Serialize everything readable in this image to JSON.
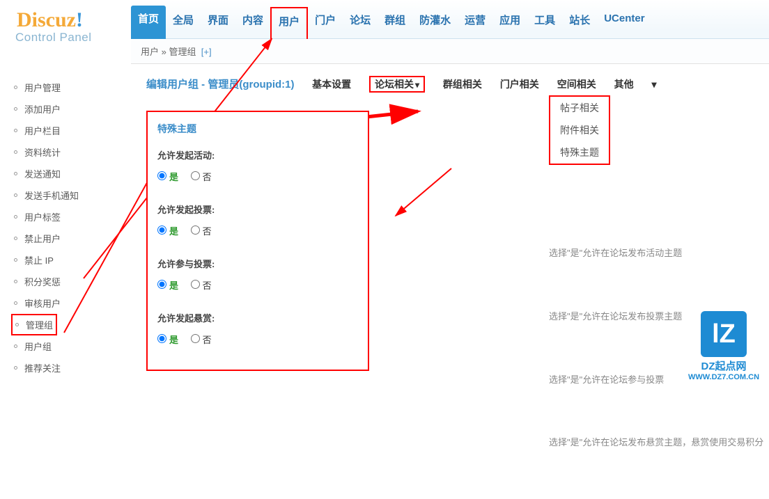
{
  "brand": {
    "name": "Discuz",
    "ex": "!",
    "subtitle": "Control Panel"
  },
  "sidebar": [
    "用户管理",
    "添加用户",
    "用户栏目",
    "资料统计",
    "发送通知",
    "发送手机通知",
    "用户标签",
    "禁止用户",
    "禁止 IP",
    "积分奖惩",
    "审核用户",
    "管理组",
    "用户组",
    "推荐关注"
  ],
  "topnav": [
    "首页",
    "全局",
    "界面",
    "内容",
    "用户",
    "门户",
    "论坛",
    "群组",
    "防灌水",
    "运营",
    "应用",
    "工具",
    "站长",
    "UCenter"
  ],
  "breadcrumb": {
    "a": "用户",
    "sep": " » ",
    "b": "管理组",
    "plus": "[+]"
  },
  "title": "编辑用户组 - 管理员(groupid:1)",
  "tabs": [
    "基本设置",
    "论坛相关",
    "群组相关",
    "门户相关",
    "空间相关",
    "其他"
  ],
  "dropdown": [
    "帖子相关",
    "附件相关",
    "特殊主题"
  ],
  "panel": {
    "heading": "特殊主题",
    "fields": [
      {
        "label": "允许发起活动:",
        "yes": "是",
        "no": "否"
      },
      {
        "label": "允许发起投票:",
        "yes": "是",
        "no": "否"
      },
      {
        "label": "允许参与投票:",
        "yes": "是",
        "no": "否"
      },
      {
        "label": "允许发起悬赏:",
        "yes": "是",
        "no": "否"
      }
    ]
  },
  "hints": [
    "选择\"是\"允许在论坛发布活动主题",
    "选择\"是\"允许在论坛发布投票主题",
    "选择\"是\"允许在论坛参与投票",
    "选择\"是\"允许在论坛发布悬赏主题，悬赏使用交易积分"
  ],
  "watermark": {
    "sq": "lZ",
    "t1": "DZ起点网",
    "t2": "WWW.DZ7.COM.CN"
  }
}
